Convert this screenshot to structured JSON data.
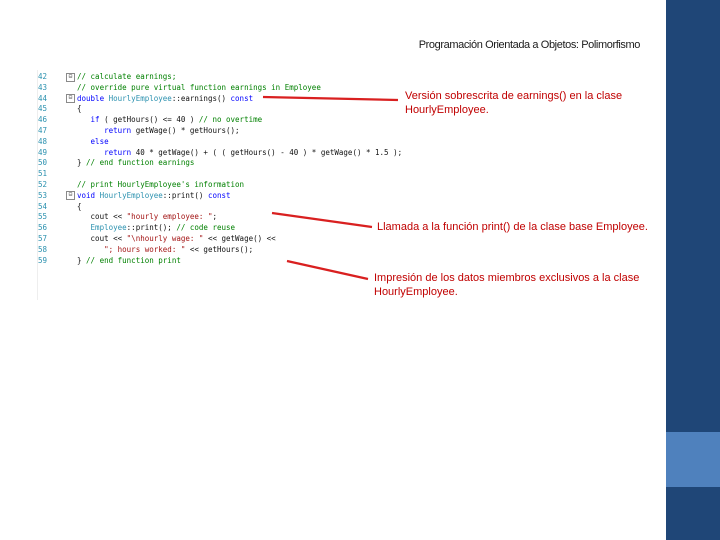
{
  "slide": {
    "title": "Programación Orientada a Objetos: Polimorfismo"
  },
  "code": {
    "line_numbers": [
      "42",
      "43",
      "44",
      "45",
      "46",
      "47",
      "48",
      "49",
      "50",
      "51",
      "52",
      "53",
      "54",
      "55",
      "56",
      "57",
      "58",
      "59"
    ],
    "lines": [
      [
        {
          "t": "// calculate earnings;",
          "c": "cm"
        }
      ],
      [
        {
          "t": "// override pure virtual function earnings in Employee",
          "c": "cm"
        }
      ],
      [
        {
          "t": "double ",
          "c": "kw"
        },
        {
          "t": "HourlyEmployee",
          "c": "ty"
        },
        {
          "t": "::earnings() ",
          "c": ""
        },
        {
          "t": "const",
          "c": "kw"
        }
      ],
      [
        {
          "t": "{",
          "c": ""
        }
      ],
      [
        {
          "t": "   if",
          "c": "kw"
        },
        {
          "t": " ( getHours() <= 40 ) ",
          "c": ""
        },
        {
          "t": "// no overtime",
          "c": "cm"
        }
      ],
      [
        {
          "t": "      return",
          "c": "kw"
        },
        {
          "t": " getWage() * getHours();",
          "c": ""
        }
      ],
      [
        {
          "t": "   else",
          "c": "kw"
        }
      ],
      [
        {
          "t": "      return",
          "c": "kw"
        },
        {
          "t": " 40 * getWage() + ( ( getHours() - 40 ) * getWage() * 1.5 );",
          "c": ""
        }
      ],
      [
        {
          "t": "} ",
          "c": ""
        },
        {
          "t": "// end function earnings",
          "c": "cm"
        }
      ],
      [
        {
          "t": "",
          "c": ""
        }
      ],
      [
        {
          "t": "// print HourlyEmployee's information",
          "c": "cm"
        }
      ],
      [
        {
          "t": "void ",
          "c": "kw"
        },
        {
          "t": "HourlyEmployee",
          "c": "ty"
        },
        {
          "t": "::print() ",
          "c": ""
        },
        {
          "t": "const",
          "c": "kw"
        }
      ],
      [
        {
          "t": "{",
          "c": ""
        }
      ],
      [
        {
          "t": "   cout << ",
          "c": ""
        },
        {
          "t": "\"hourly employee: \"",
          "c": "st"
        },
        {
          "t": ";",
          "c": ""
        }
      ],
      [
        {
          "t": "   Employee",
          "c": "ty"
        },
        {
          "t": "::print(); ",
          "c": ""
        },
        {
          "t": "// code reuse",
          "c": "cm"
        }
      ],
      [
        {
          "t": "   cout << ",
          "c": ""
        },
        {
          "t": "\"\\nhourly wage: \"",
          "c": "st"
        },
        {
          "t": " << getWage() <<",
          "c": ""
        }
      ],
      [
        {
          "t": "      ",
          "c": ""
        },
        {
          "t": "\"; hours worked: \"",
          "c": "st"
        },
        {
          "t": " << getHours();",
          "c": ""
        }
      ],
      [
        {
          "t": "} ",
          "c": ""
        },
        {
          "t": "// end function print",
          "c": "cm"
        }
      ]
    ],
    "fold_markers": {
      "42": "⊟",
      "44": "⊟",
      "53": "⊟"
    }
  },
  "annotations": {
    "earnings_note": [
      "Versión sobrescrita de earnings() en la clase",
      "HourlyEmployee."
    ],
    "print_base_note": [
      "Llamada a la función print() de la clase base Employee."
    ],
    "print_members_note": [
      "Impresión de los datos miembros exclusivos a la clase",
      "HourlyEmployee."
    ]
  },
  "colors": {
    "sidebar": "#1f4677",
    "sidebar_accent": "#4f81bd",
    "annotation": "#c00000",
    "arrow": "#d92020"
  }
}
